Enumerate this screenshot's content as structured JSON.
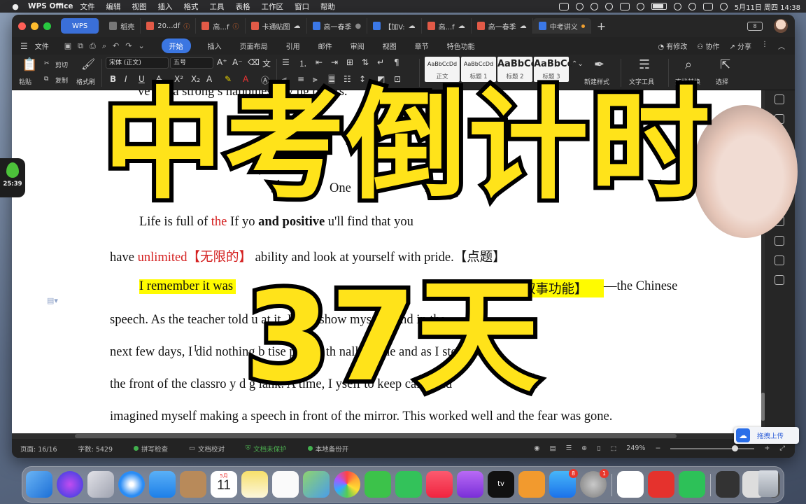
{
  "menubar": {
    "app_name": "WPS Office",
    "items": [
      "文件",
      "编辑",
      "视图",
      "插入",
      "格式",
      "工具",
      "表格",
      "工作区",
      "窗口",
      "帮助"
    ],
    "clock": "5月11日 周四  14:38"
  },
  "tabs": [
    {
      "label": "WPS",
      "kind": "home"
    },
    {
      "label": "稻壳",
      "kind": "gray"
    },
    {
      "label": "20...df",
      "kind": "pdf",
      "warn": true
    },
    {
      "label": "高...f",
      "kind": "pdf",
      "warn": true
    },
    {
      "label": "卡通贴图",
      "kind": "pdf"
    },
    {
      "label": "高一春季",
      "kind": "doc",
      "dot": true
    },
    {
      "label": "【加V:",
      "kind": "doc"
    },
    {
      "label": "高...f",
      "kind": "pdf"
    },
    {
      "label": "高一春季",
      "kind": "pdf"
    },
    {
      "label": "中考讲义",
      "kind": "doc",
      "active": true
    }
  ],
  "ribbon_tabs": {
    "file": "文件",
    "items": [
      "开始",
      "插入",
      "页面布局",
      "引用",
      "邮件",
      "审阅",
      "视图",
      "章节",
      "特色功能"
    ],
    "right": [
      "有修改",
      "协作",
      "分享"
    ]
  },
  "ribbon": {
    "paste": "粘贴",
    "cut": "剪切",
    "copy": "复制",
    "format_painter": "格式刷",
    "font_name": "宋体 (正文)",
    "font_size": "五号",
    "styles": [
      {
        "sample": "AaBbCcDd",
        "name": "正文"
      },
      {
        "sample": "AaBbCcDd",
        "name": "标题 1"
      },
      {
        "sample": "AaBbCc",
        "name": "标题 2"
      },
      {
        "sample": "AaBbCc",
        "name": "标题 3"
      }
    ],
    "new_style": "新建样式",
    "text_tools": "文字工具",
    "find_replace": "查找替换",
    "select": "选择"
  },
  "document": {
    "line0": "ve got a strong s      happiness by      ng others.",
    "line_one": "One",
    "line1_a": "Life is full of ",
    "line1_red": "the",
    "line1_b": "              If yo",
    "line1_bold": "             and positive",
    "line1_c": "        u'll find that you",
    "line2_a": "have ",
    "line2_red": "unlimited【无限的】",
    "line2_b": "  ability and look at yourself with pride.【点题】",
    "line3_hl": "I remember it was",
    "line3_hl2": "叙事功能】",
    "line3_c": "—the Chinese",
    "line4": "speech. As the teacher told u     at it, I ca       k                       show myself. And in the",
    "line5": "next few days, I did nothing b        tise      peech.              th      nally came and as I stood in",
    "line6": "the front of the classro        y      d g    lank. A           time, I            yself to keep calm and",
    "line7": "imagined myself making a speech in front of the mirror. This worked well and the fear was gone."
  },
  "overlay": {
    "title": "中考倒计时",
    "days": "37天"
  },
  "timer_widget": {
    "time": "25:39"
  },
  "statusbar": {
    "page": "页面: 16/16",
    "words": "字数: 5429",
    "spell": "拼写检查",
    "proof": "文档校对",
    "protect": "文档未保护",
    "backup": "本地备份开",
    "zoom": "249%"
  },
  "upload": {
    "label": "拖拽上传"
  },
  "dock": {
    "calendar_month": "5月",
    "calendar_day": "11",
    "appstore_badge": "8",
    "settings_badge": "1"
  }
}
